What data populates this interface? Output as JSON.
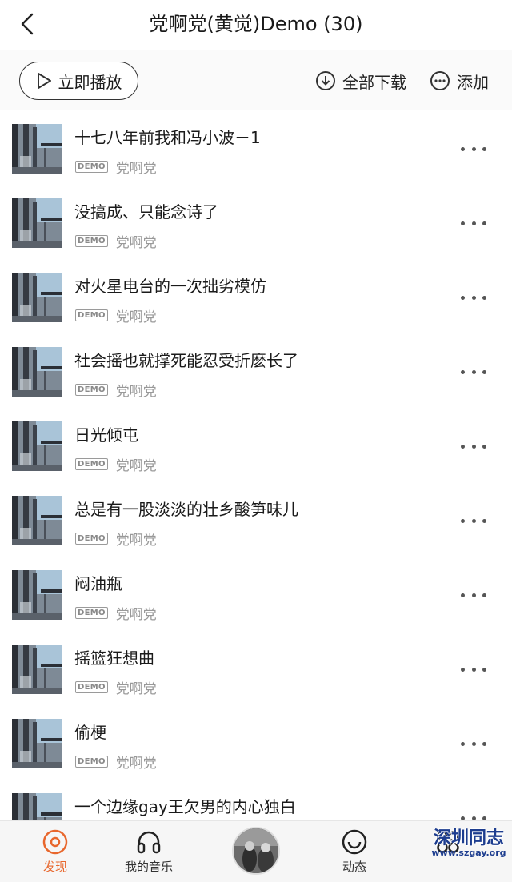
{
  "header": {
    "title": "党啊党(黄觉)Demo (30)",
    "back_icon": "chevron-left-icon"
  },
  "toolbar": {
    "play_all_label": "立即播放",
    "download_all_label": "全部下载",
    "add_label": "添加"
  },
  "songs": [
    {
      "title": "十七八年前我和冯小波－1",
      "tag": "DEMO",
      "artist": "党啊党"
    },
    {
      "title": "没搞成、只能念诗了",
      "tag": "DEMO",
      "artist": "党啊党"
    },
    {
      "title": "对火星电台的一次拙劣模仿",
      "tag": "DEMO",
      "artist": "党啊党"
    },
    {
      "title": "社会摇也就撑死能忍受折麽长了",
      "tag": "DEMO",
      "artist": "党啊党"
    },
    {
      "title": "日光倾屯",
      "tag": "DEMO",
      "artist": "党啊党"
    },
    {
      "title": "总是有一股淡淡的壮乡酸笋味儿",
      "tag": "DEMO",
      "artist": "党啊党"
    },
    {
      "title": "闷油瓶",
      "tag": "DEMO",
      "artist": "党啊党"
    },
    {
      "title": "摇篮狂想曲",
      "tag": "DEMO",
      "artist": "党啊党"
    },
    {
      "title": "偷梗",
      "tag": "DEMO",
      "artist": "党啊党"
    },
    {
      "title": "一个边缘gay王欠男的内心独白",
      "tag": "",
      "artist": ""
    }
  ],
  "nav": {
    "discover_label": "发现",
    "my_music_label": "我的音乐",
    "feed_label": "动态",
    "accent_color": "#e8672d"
  },
  "watermark": {
    "text": "深圳同志",
    "url": "www.szgay.org"
  }
}
